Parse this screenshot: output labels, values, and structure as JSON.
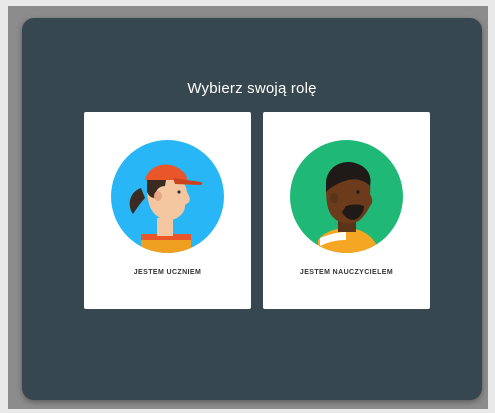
{
  "dialog": {
    "title": "Wybierz swoją rolę"
  },
  "roles": [
    {
      "label": "JESTEM UCZNIEM",
      "avatar_icon": "student-avatar-icon",
      "circle_color": "#29b6f6"
    },
    {
      "label": "JESTEM NAUCZYCIELEM",
      "avatar_icon": "teacher-avatar-icon",
      "circle_color": "#1fb877"
    }
  ],
  "colors": {
    "dialog_background": "#37474f",
    "card_background": "#ffffff",
    "cap_color": "#e8562a",
    "shirt_stripe": "#f5a623"
  }
}
